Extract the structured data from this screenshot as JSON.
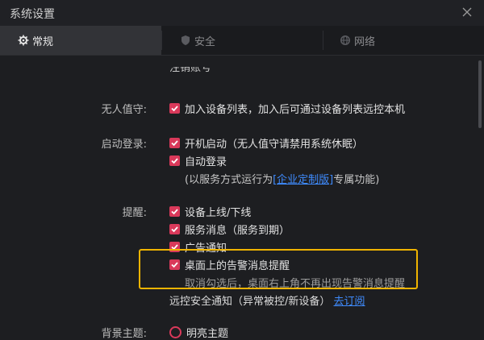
{
  "window": {
    "title": "系统设置"
  },
  "tabs": [
    {
      "label": "常规",
      "icon": "gear-icon"
    },
    {
      "label": "安全",
      "icon": "shield-icon"
    },
    {
      "label": "网络",
      "icon": "globe-icon"
    }
  ],
  "colors": {
    "accent": "#d9395a",
    "link": "#3f8cff",
    "highlight": "#f0b400"
  },
  "content": {
    "cut_text": "注销账号",
    "unattended": {
      "label": "无人值守:",
      "option": "加入设备列表，加入后可通过设备列表远控本机"
    },
    "startup": {
      "label": "启动登录:",
      "options": [
        "开机启动（无人值守请禁用系统休眠）",
        "自动登录"
      ],
      "note_prefix": "(以服务方式运行为",
      "note_link": "[企业定制版]",
      "note_suffix": "专属功能)"
    },
    "reminders": {
      "label": "提醒:",
      "options": [
        "设备上线/下线",
        "服务消息（服务到期）",
        "广告通知",
        "桌面上的告警消息提醒"
      ],
      "alert_hint": "取消勾选后，桌面右上角不再出现告警消息提醒",
      "security_text": "远控安全通知（异常被控/新设备）",
      "security_link": "去订阅"
    },
    "theme": {
      "label": "背景主题:",
      "option": "明亮主题"
    }
  }
}
